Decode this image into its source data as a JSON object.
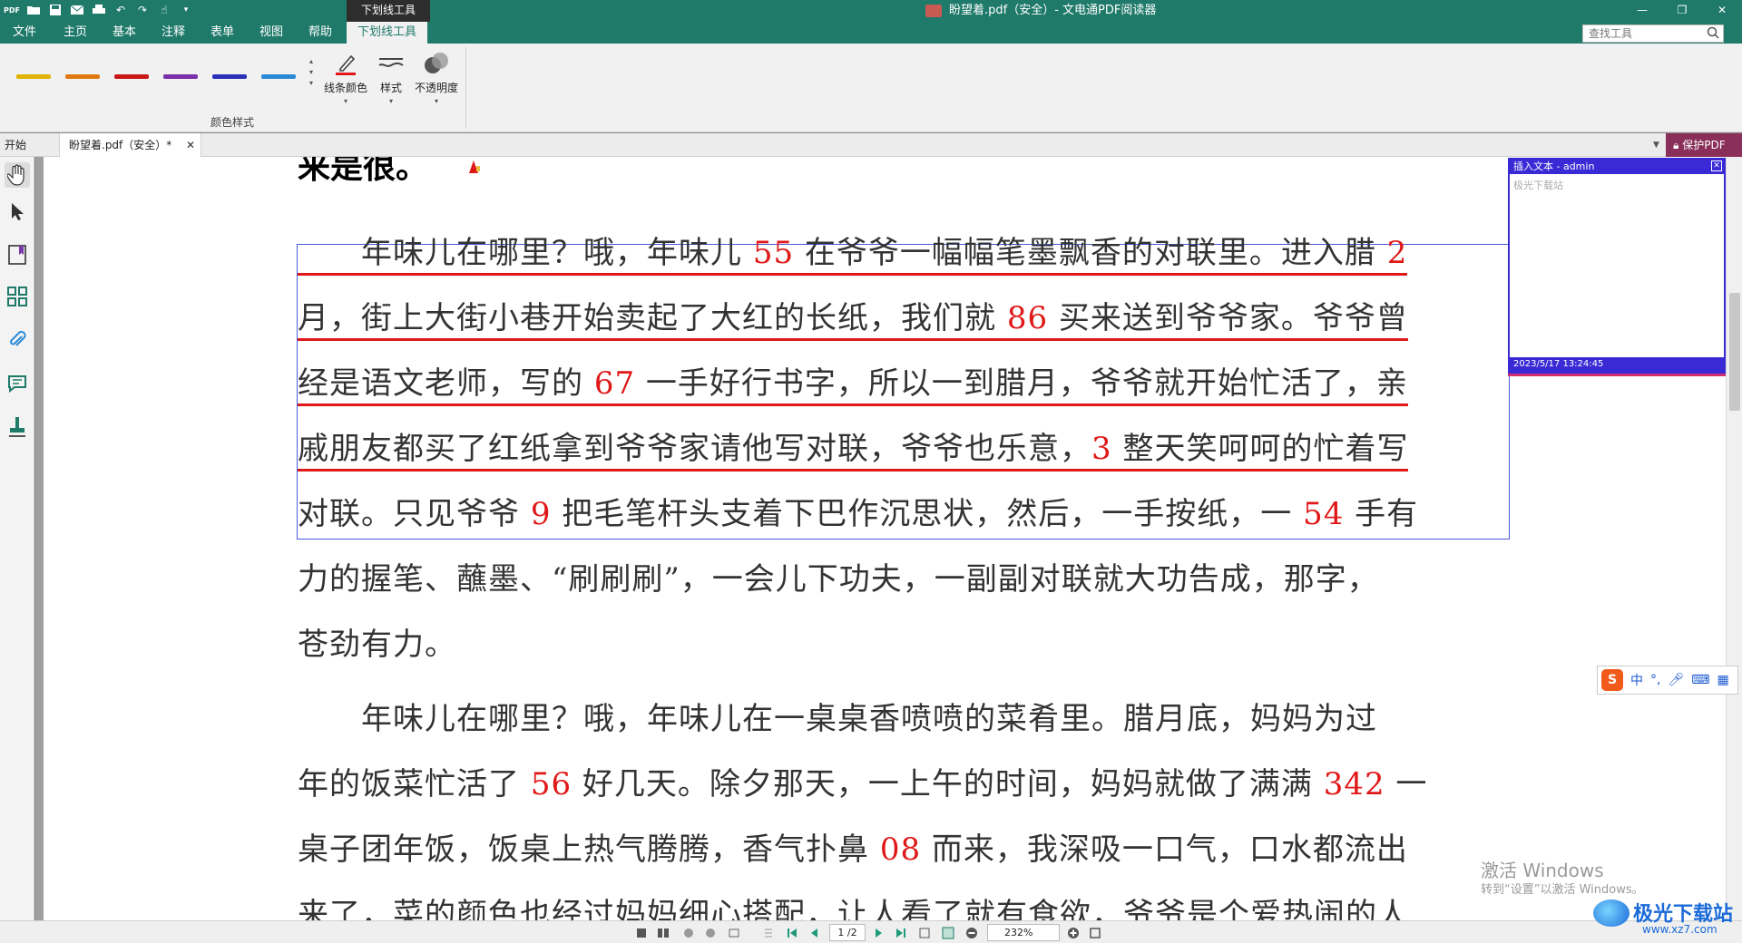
{
  "titlebar": {
    "context_tab_title": "下划线工具",
    "window_title": "盼望着.pdf（安全）- 文电通PDF阅读器",
    "controls": [
      "—",
      "❐",
      "✕"
    ]
  },
  "menu": {
    "items": [
      "文件",
      "主页",
      "基本",
      "注释",
      "表单",
      "视图",
      "帮助"
    ],
    "active_tab": "下划线工具",
    "search_placeholder": "查找工具"
  },
  "ribbon": {
    "swatches": [
      "#e0b400",
      "#e07a10",
      "#c81818",
      "#7a30a8",
      "#2830b8",
      "#2a8ad8"
    ],
    "group_label": "颜色样式",
    "line_color_label": "线条颜色",
    "style_label": "样式",
    "opacity_label": "不透明度"
  },
  "tabs": {
    "start": "开始",
    "doc_tab": "盼望着.pdf（安全）*",
    "protect": "保护PDF"
  },
  "document": {
    "heading_fragment": "来是很。",
    "paragraphs": [
      {
        "lines": [
          "　　年味儿在哪里？哦，年味儿 |55| 在爷爷一幅幅笔墨飘香的对联里。进入腊 |2|",
          "月，街上大街小巷开始卖起了大红的长纸，我们就 |86| 买来送到爷爷家。爷爷曾",
          "经是语文老师，写的 |67| 一手好行书字，所以一到腊月，爷爷就开始忙活了，亲",
          "戚朋友都买了红纸拿到爷爷家请他写对联，爷爷也乐意，|3| 整天笑呵呵的忙着写",
          "对联。只见爷爷 |9| 把毛笔杆头支着下巴作沉思状，然后，一手按纸，一 |54| 手有",
          "力的握笔、蘸墨、“刷刷刷”，一会儿下功夫，一副副对联就大功告成，那字，",
          "苍劲有力。"
        ]
      },
      {
        "lines": [
          "　　年味儿在哪里？哦，年味儿在一桌桌香喷喷的菜肴里。腊月底，妈妈为过",
          "年的饭菜忙活了 |56| 好几天。除夕那天，一上午的时间，妈妈就做了满满 |342| 一",
          "桌子团年饭，饭桌上热气腾腾，香气扑鼻 |08| 而来，我深吸一口气，口水都流出",
          "来了，菜的颜色也经过妈妈细心搭配，让人看了就有食欲，爷爷是个爱热闹的人"
        ]
      }
    ]
  },
  "comment": {
    "title": "插入文本 - admin",
    "body": "极光下载站",
    "timestamp": "2023/5/17 13:24:45"
  },
  "ime": {
    "label": "中",
    "punct": "°,"
  },
  "watermark": {
    "line1": "激活 Windows",
    "line2": "转到“设置”以激活 Windows。"
  },
  "statusbar": {
    "page": "1 /2",
    "zoom": "232%"
  },
  "site_logo": {
    "name": "极光下载站",
    "url": "www.xz7.com"
  }
}
